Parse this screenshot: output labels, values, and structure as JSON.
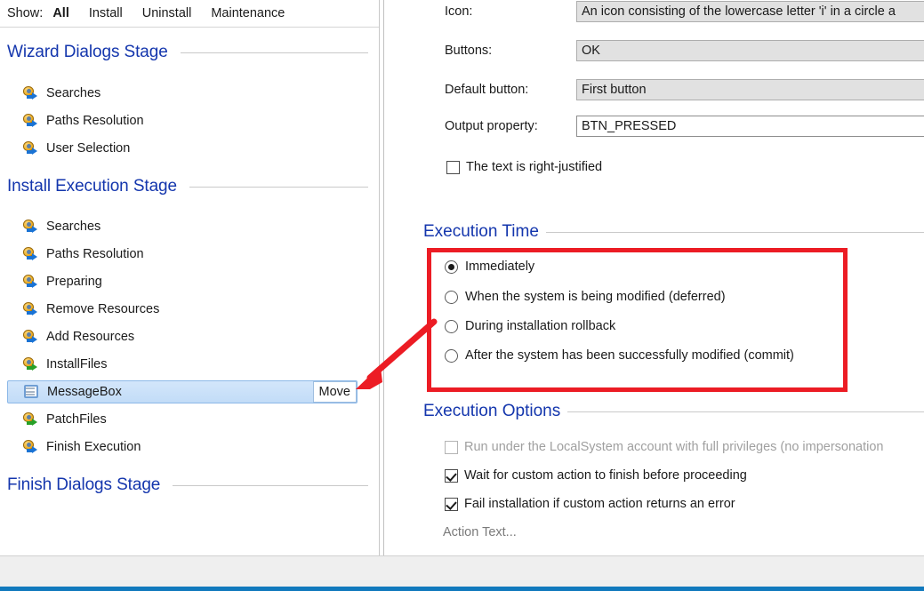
{
  "show_bar": {
    "label": "Show:",
    "filters": [
      {
        "label": "All",
        "active": true
      },
      {
        "label": "Install",
        "active": false
      },
      {
        "label": "Uninstall",
        "active": false
      },
      {
        "label": "Maintenance",
        "active": false
      }
    ]
  },
  "tree": {
    "stages": [
      {
        "title": "Wizard Dialogs Stage",
        "items": [
          {
            "label": "Searches",
            "icon": "custom-action-icon",
            "arrow": "blue"
          },
          {
            "label": "Paths Resolution",
            "icon": "custom-action-icon",
            "arrow": "blue"
          },
          {
            "label": "User Selection",
            "icon": "custom-action-icon",
            "arrow": "blue"
          }
        ]
      },
      {
        "title": "Install Execution Stage",
        "items": [
          {
            "label": "Searches",
            "icon": "custom-action-icon",
            "arrow": "blue"
          },
          {
            "label": "Paths Resolution",
            "icon": "custom-action-icon",
            "arrow": "blue"
          },
          {
            "label": "Preparing",
            "icon": "custom-action-icon",
            "arrow": "blue"
          },
          {
            "label": "Remove Resources",
            "icon": "custom-action-icon",
            "arrow": "blue"
          },
          {
            "label": "Add Resources",
            "icon": "custom-action-icon",
            "arrow": "blue"
          },
          {
            "label": "InstallFiles",
            "icon": "custom-action-icon",
            "arrow": "green"
          },
          {
            "label": "MessageBox",
            "icon": "dialog-icon",
            "selected": true,
            "button": "Move"
          },
          {
            "label": "PatchFiles",
            "icon": "custom-action-icon",
            "arrow": "green"
          },
          {
            "label": "Finish Execution",
            "icon": "custom-action-icon",
            "arrow": "blue"
          }
        ]
      },
      {
        "title": "Finish Dialogs Stage",
        "items": []
      }
    ]
  },
  "details": {
    "fields": [
      {
        "label": "Icon:",
        "value": "An icon consisting of the lowercase letter 'i' in a circle a",
        "type": "combo"
      },
      {
        "label": "Buttons:",
        "value": "OK",
        "type": "combo"
      },
      {
        "label": "Default button:",
        "value": "First button",
        "type": "combo"
      },
      {
        "label": "Output property:",
        "value": "BTN_PRESSED",
        "type": "textbox"
      }
    ],
    "right_justified": {
      "label": "The text is right-justified",
      "checked": false
    }
  },
  "execution_time": {
    "title": "Execution Time",
    "options": [
      {
        "label": "Immediately",
        "selected": true
      },
      {
        "label": "When the system is being modified (deferred)",
        "selected": false
      },
      {
        "label": "During installation rollback",
        "selected": false
      },
      {
        "label": "After the system has been successfully modified (commit)",
        "selected": false
      }
    ]
  },
  "execution_options": {
    "title": "Execution Options",
    "items": [
      {
        "label": "Run under the LocalSystem account with full privileges (no impersonation",
        "checked": false,
        "disabled": true
      },
      {
        "label": "Wait for custom action to finish before proceeding",
        "checked": true,
        "disabled": false
      },
      {
        "label": "Fail installation if custom action returns an error",
        "checked": true,
        "disabled": false
      }
    ],
    "action_text_link": "Action Text..."
  },
  "annotation": {
    "color": "#ec1c24",
    "shape": "rounded-rectangle-with-arrow",
    "points_to": "Move"
  },
  "colors": {
    "heading_blue": "#1436ad",
    "selection_blue": "#c2dcf7",
    "annotation_red": "#ec1c24",
    "taskbar_blue": "#1179bd"
  }
}
